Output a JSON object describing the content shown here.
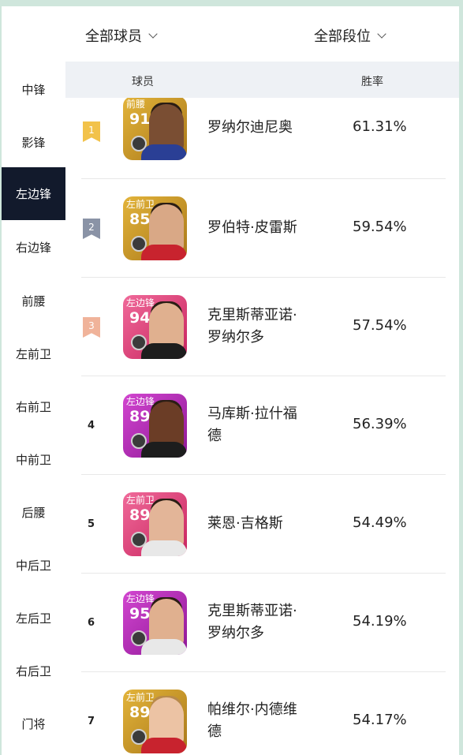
{
  "filters": {
    "players_label": "全部球员",
    "tiers_label": "全部段位"
  },
  "sidebar": {
    "items": [
      {
        "label": "中锋"
      },
      {
        "label": "影锋"
      },
      {
        "label": "左边锋"
      },
      {
        "label": "右边锋"
      },
      {
        "label": "前腰"
      },
      {
        "label": "左前卫"
      },
      {
        "label": "右前卫"
      },
      {
        "label": "中前卫"
      },
      {
        "label": "后腰"
      },
      {
        "label": "中后卫"
      },
      {
        "label": "左后卫"
      },
      {
        "label": "右后卫"
      },
      {
        "label": "门将"
      }
    ],
    "active": "左边锋"
  },
  "table": {
    "headers": {
      "player": "球员",
      "win_rate": "胜率"
    },
    "rows": [
      {
        "rank": "1",
        "position": "前腰",
        "rating": "91",
        "name": "罗纳尔迪尼奥",
        "win_rate": "61.31%",
        "card_color": "#d9a52f"
      },
      {
        "rank": "2",
        "position": "左前卫",
        "rating": "85",
        "name": "罗伯特·皮雷斯",
        "win_rate": "59.54%",
        "card_color": "#d9a52f"
      },
      {
        "rank": "3",
        "position": "左边锋",
        "rating": "94",
        "name": "克里斯蒂亚诺·\n罗纳尔多",
        "win_rate": "57.54%",
        "card_color": "#e0457e"
      },
      {
        "rank": "4",
        "position": "左边锋",
        "rating": "89",
        "name": "马库斯·拉什福\n德",
        "win_rate": "56.39%",
        "card_color": "#b42fb8"
      },
      {
        "rank": "5",
        "position": "左前卫",
        "rating": "89",
        "name": "莱恩·吉格斯",
        "win_rate": "54.49%",
        "card_color": "#e0457e"
      },
      {
        "rank": "6",
        "position": "左边锋",
        "rating": "95",
        "name": "克里斯蒂亚诺·\n罗纳尔多",
        "win_rate": "54.19%",
        "card_color": "#b42fb8"
      },
      {
        "rank": "7",
        "position": "左前卫",
        "rating": "89",
        "name": "帕维尔·内德维\n德",
        "win_rate": "54.17%",
        "card_color": "#d9a52f"
      }
    ]
  },
  "colors": {
    "active_bg": "#121a2c",
    "header_bg": "#eef1f5",
    "rank1": "#f2c24a",
    "rank2": "#8a93a6",
    "rank3": "#f0b39a"
  }
}
